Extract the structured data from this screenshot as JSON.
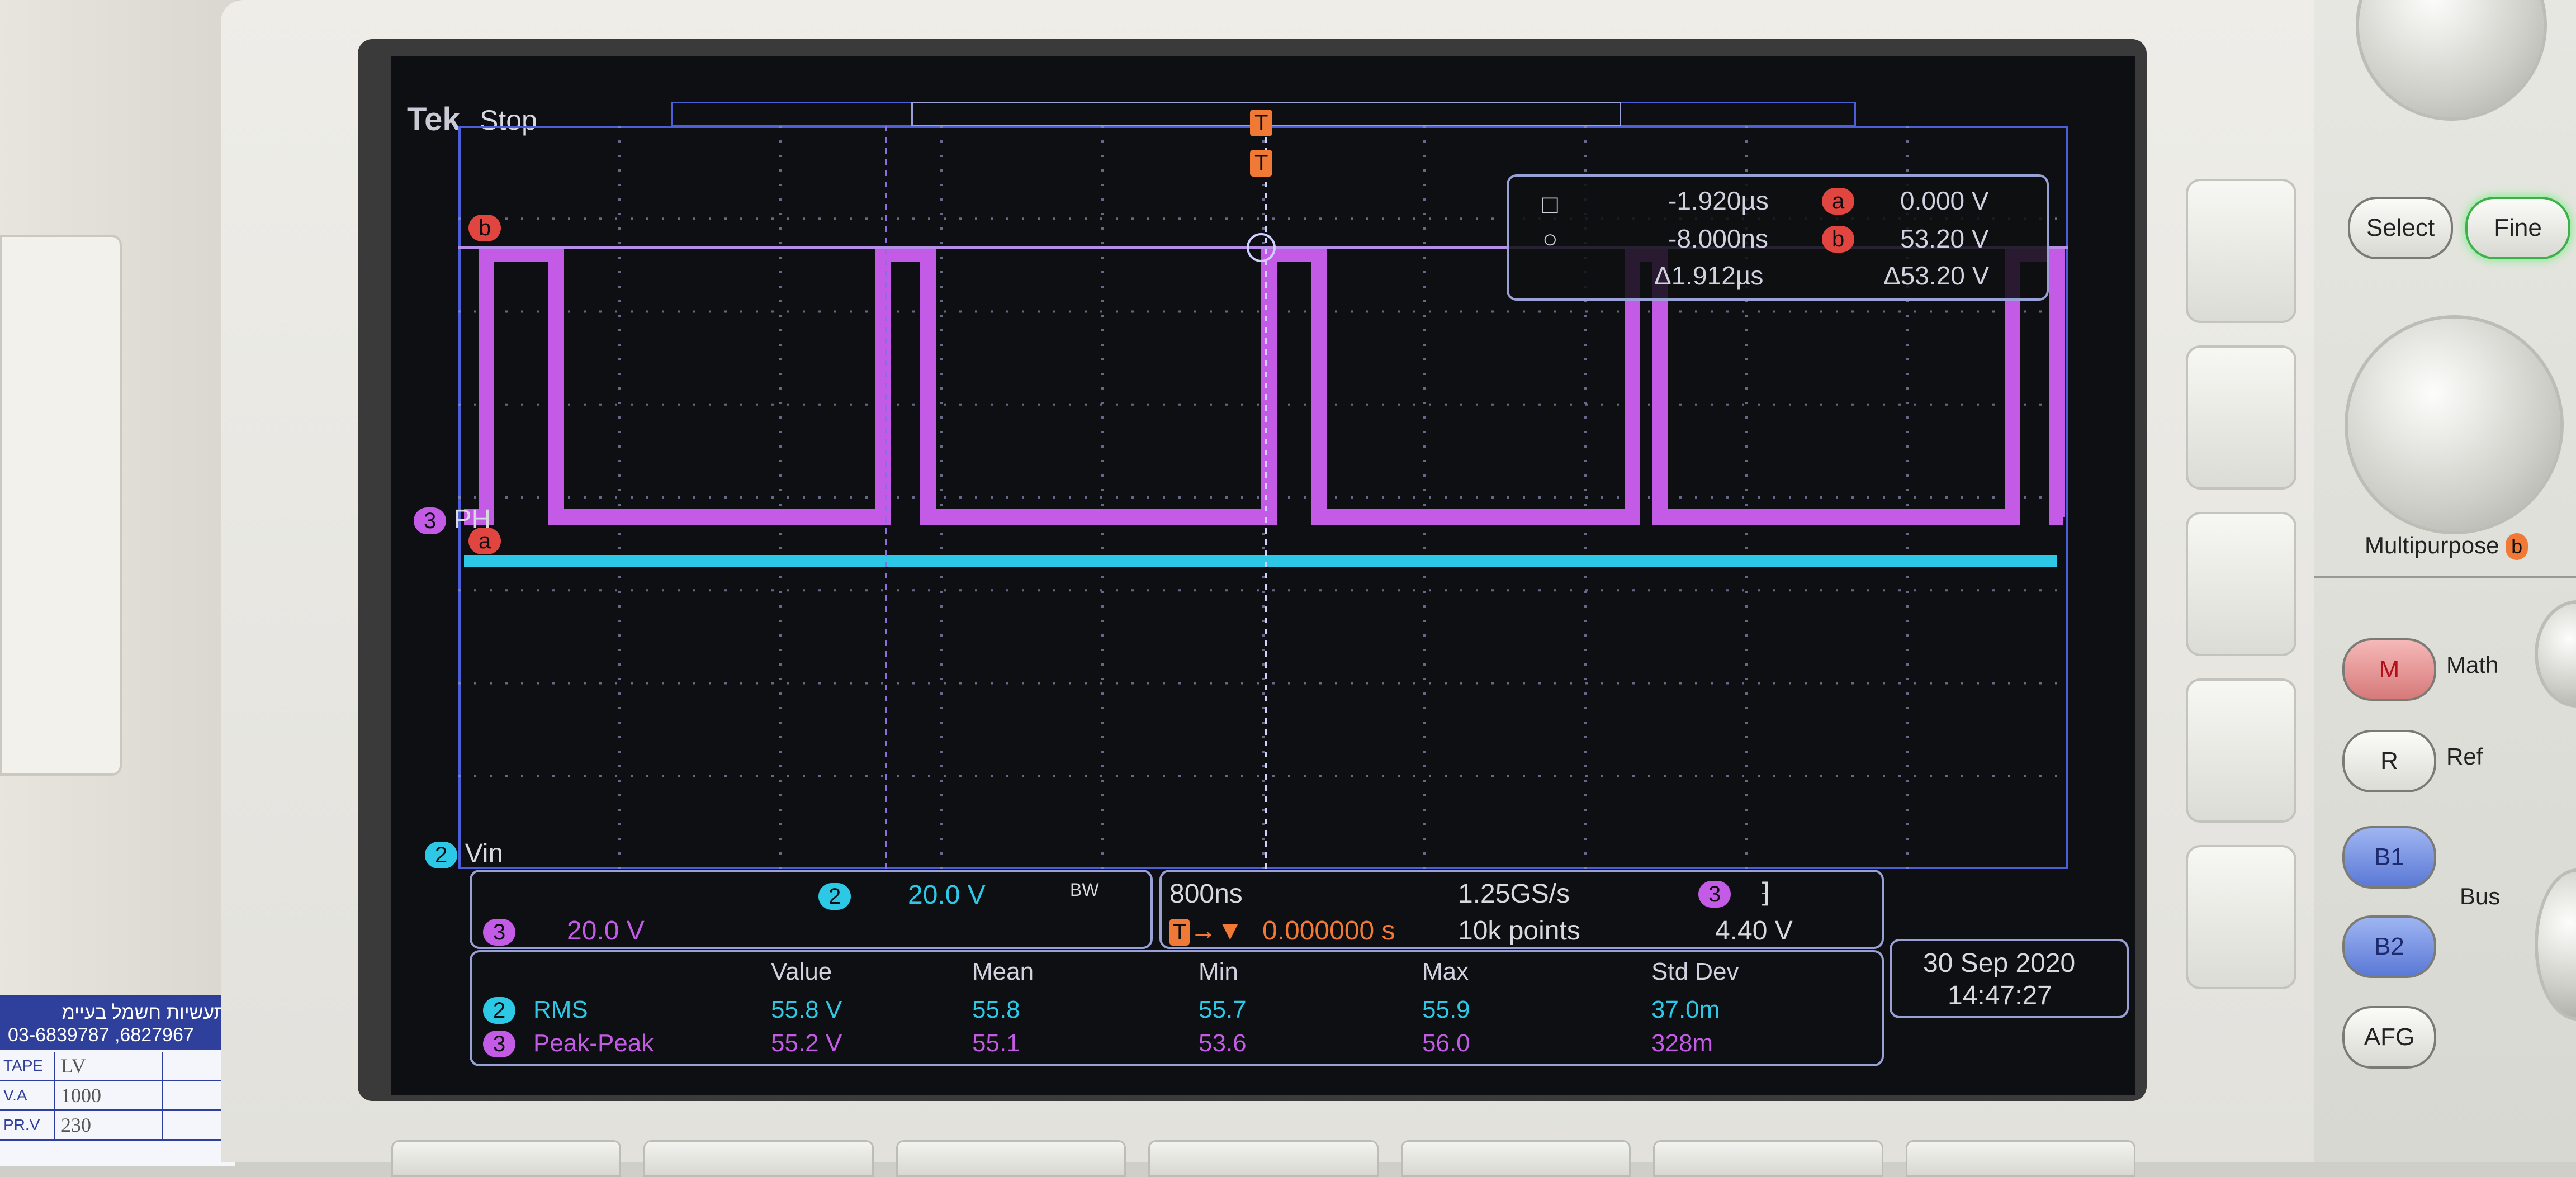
{
  "label_plate": {
    "company": "תעשיות חשמל בעיימ",
    "phone": "03-6839787 ,6827967",
    "rows": [
      {
        "key": "TAPE",
        "value": "LV"
      },
      {
        "key": "V.A",
        "value": "1000"
      },
      {
        "key": "PR.V",
        "value": "230"
      }
    ]
  },
  "scope": {
    "brand": "Tek",
    "acq_state": "Stop",
    "trigger_marker": "T",
    "cursor_a_label": "a",
    "cursor_b_label": "b",
    "ch3_marker": "3",
    "ch3_name": "PH",
    "ch2_marker": "2",
    "ch2_name": "Vin",
    "cursor_readout": {
      "row1_time": "-1.920µs",
      "row1_volt": "0.000 V",
      "row2_time": "-8.000ns",
      "row2_volt": "53.20 V",
      "delta_time": "Δ1.912µs",
      "delta_volt": "Δ53.20 V"
    },
    "vertical": {
      "ch2_scale": "20.0 V",
      "ch2_bw": "BW",
      "ch3_scale": "20.0 V"
    },
    "horizontal": {
      "timebase": "800ns",
      "sample_rate": "1.25GS/s",
      "trigger_pos": "0.000000 s",
      "record_length": "10k points",
      "trigger_source": "3",
      "trigger_level": "4.40 V"
    },
    "measurements": {
      "headers": [
        "Value",
        "Mean",
        "Min",
        "Max",
        "Std Dev"
      ],
      "rows": [
        {
          "ch": "2",
          "name": "RMS",
          "value": "55.8 V",
          "mean": "55.8",
          "min": "55.7",
          "max": "55.9",
          "std": "37.0m"
        },
        {
          "ch": "3",
          "name": "Peak-Peak",
          "value": "55.2 V",
          "mean": "55.1",
          "min": "53.6",
          "max": "56.0",
          "std": "328m"
        }
      ]
    },
    "date": "30 Sep  2020",
    "time": "14:47:27",
    "colors": {
      "ch2": "#2cc8e6",
      "ch3": "#c35be6",
      "cursor": "#f07a35",
      "grid": "#4d5fd8"
    }
  },
  "panel": {
    "select": "Select",
    "fine": "Fine",
    "multipurpose": "Multipurpose",
    "multipurpose_tag": "b",
    "math_key": "M",
    "math": "Math",
    "ref_key": "R",
    "ref": "Ref",
    "b1": "B1",
    "b2": "B2",
    "bus": "Bus",
    "afg": "AFG"
  }
}
